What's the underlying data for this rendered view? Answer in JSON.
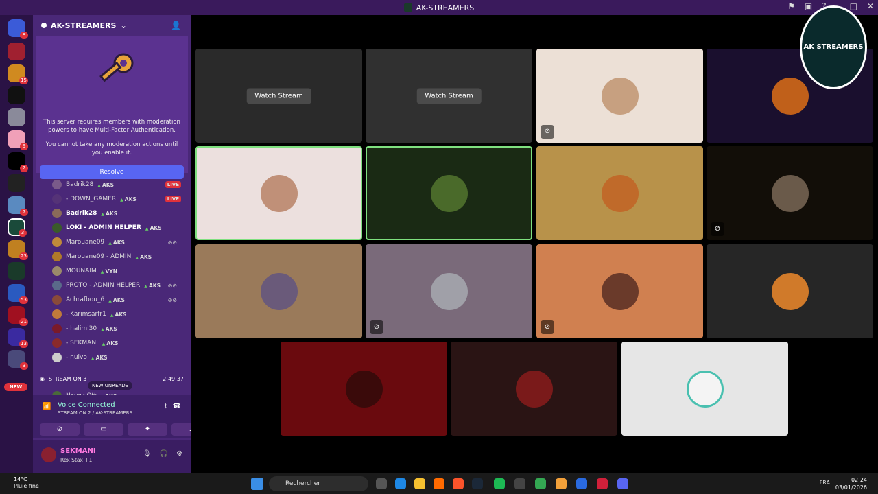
{
  "window": {
    "title": "AK-STREAMERS"
  },
  "server": {
    "name": "AK-STREAMERS",
    "mfa_line1": "This server requires members with moderation powers to have Multi-Factor Authentication.",
    "mfa_line2": "You cannot take any moderation actions until you enable it.",
    "resolve_label": "Resolve"
  },
  "rail": {
    "badges": [
      "8",
      "15",
      "9",
      "2",
      "7",
      "3",
      "23",
      "53",
      "21",
      "13",
      "3"
    ],
    "new_label": "NEW"
  },
  "voice_members": [
    {
      "name": "Badrik28",
      "tag": "AKS",
      "status": "LIVE",
      "avatar_color": "#7a5a8a"
    },
    {
      "name": "- DOWN_GAMER",
      "tag": "AKS",
      "status": "LIVE",
      "avatar_color": "#553377"
    },
    {
      "name": "Badrik28",
      "tag": "AKS",
      "status": "",
      "avatar_color": "#8a6a5a"
    },
    {
      "name": "LOKI - ADMIN HELPER",
      "tag": "AKS",
      "status": "",
      "avatar_color": "#3a5a2a"
    },
    {
      "name": "Marouane09",
      "tag": "AKS",
      "status": "",
      "avatar_color": "#c08a3a"
    },
    {
      "name": "Marouane09 - ADMIN",
      "tag": "AKS",
      "status": "",
      "avatar_color": "#b07a2a"
    },
    {
      "name": "MOUNAIM",
      "tag": "VYN",
      "status": "",
      "avatar_color": "#9a8a6a"
    },
    {
      "name": "PROTO - ADMIN HELPER",
      "tag": "AKS",
      "status": "",
      "avatar_color": "#5a6a8a"
    },
    {
      "name": "Achrafbou_6",
      "tag": "AKS",
      "status": "",
      "avatar_color": "#8a4a3a"
    },
    {
      "name": "- Karimsarfr1",
      "tag": "AKS",
      "status": "",
      "avatar_color": "#c07a3a"
    },
    {
      "name": "- halimi30",
      "tag": "AKS",
      "status": "",
      "avatar_color": "#7a1a2a"
    },
    {
      "name": "- SEKMANI",
      "tag": "AKS",
      "status": "",
      "avatar_color": "#8a2a2a"
    },
    {
      "name": "- nulvo",
      "tag": "AKS",
      "status": "",
      "avatar_color": "#ccc"
    }
  ],
  "stream_channel": {
    "name": "STREAM ON 3",
    "timer": "2:49:37",
    "next_member": "Nayzk Ott",
    "next_tag": "AKS"
  },
  "new_unreads": "NEW UNREADS",
  "voice_panel": {
    "status": "Voice Connected",
    "channel": "STREAM ON 2 / AK-STREAMERS"
  },
  "user": {
    "name": "SEKMANI",
    "activity": "Rex Stax +1"
  },
  "tiles": [
    {
      "kind": "stream",
      "bg": "#2a2a2a",
      "label": "Watch Stream"
    },
    {
      "kind": "stream",
      "bg": "#303030",
      "label": "Watch Stream"
    },
    {
      "kind": "user",
      "bg": "#ece0d6",
      "pfp": "#c7a080",
      "deaf": true
    },
    {
      "kind": "user",
      "bg": "#1a0f2e",
      "pfp": "#c0601a",
      "deaf": false
    },
    {
      "kind": "user",
      "bg": "#ece0de",
      "pfp": "#c09078",
      "deaf": false,
      "speaking": true
    },
    {
      "kind": "user",
      "bg": "#1a2a14",
      "pfp": "#4a6a2a",
      "deaf": false,
      "speaking": true
    },
    {
      "kind": "user",
      "bg": "#b8924a",
      "pfp": "#c06a2a",
      "deaf": false
    },
    {
      "kind": "user",
      "bg": "#120e08",
      "pfp": "#6a5a4a",
      "deaf": true
    },
    {
      "kind": "user",
      "bg": "#9a7a5a",
      "pfp": "#6a5a7a",
      "deaf": false
    },
    {
      "kind": "user",
      "bg": "#7a6a7a",
      "pfp": "#a0a0a8",
      "deaf": true
    },
    {
      "kind": "user",
      "bg": "#d08050",
      "pfp": "#6a3a2a",
      "deaf": true
    },
    {
      "kind": "user",
      "bg": "#262626",
      "pfp": "#d07a2a",
      "deaf": false
    },
    {
      "kind": "user",
      "bg": "#6a0a0e",
      "pfp": "#3a0a0a",
      "deaf": false
    },
    {
      "kind": "user",
      "bg": "#2a1414",
      "pfp": "#7a1a1a",
      "deaf": false
    },
    {
      "kind": "user",
      "bg": "#e6e6e6",
      "pfp": "#f4f4f4",
      "deaf": false
    }
  ],
  "brand_badge": {
    "text": "AK STREAMERS"
  },
  "taskbar": {
    "weather_temp": "14°C",
    "weather_desc": "Pluie fine",
    "search_placeholder": "Rechercher",
    "lang": "FRA",
    "time": "02:24",
    "date": "03/01/2026"
  }
}
